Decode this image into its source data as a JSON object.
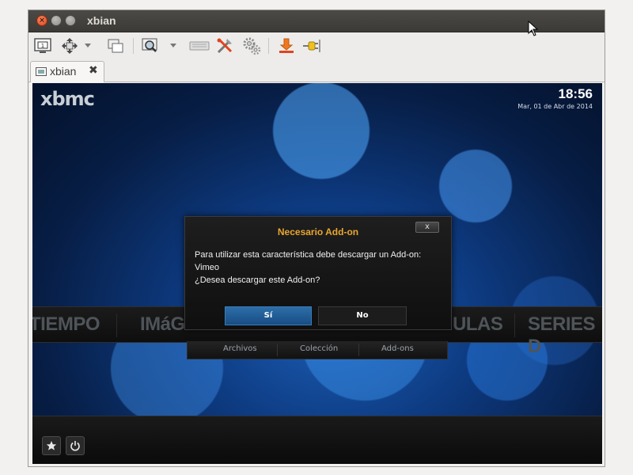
{
  "window": {
    "title": "xbian",
    "controls": [
      "close-icon",
      "minimize-icon",
      "maximize-icon"
    ]
  },
  "toolbar": {
    "buttons": [
      "fit-screen-icon",
      "move-icon",
      "dropdown-chevron",
      "windows-icon",
      "zoom-icon",
      "dropdown-chevron",
      "keyboard-icon",
      "tools-icon",
      "settings-gears-icon",
      "download-icon",
      "plug-icon"
    ]
  },
  "tabs": [
    {
      "label": "xbian",
      "icon": "display-icon",
      "close_icon": "close-x-icon"
    }
  ],
  "xbmc": {
    "logo": "xbmc",
    "time": "18:56",
    "date": "Mar, 01 de Abr de 2014",
    "menu": [
      "TIEMPO",
      "IMáG",
      "ULAS",
      "SERIES D"
    ],
    "submenu": [
      "Archivos",
      "Colección",
      "Add-ons"
    ],
    "bottom_buttons": [
      "star-icon",
      "power-icon"
    ]
  },
  "dialog": {
    "title": "Necesario Add-on",
    "close_label": "x",
    "lines": [
      "Para utilizar esta característica debe descargar un Add-on:",
      "Vimeo",
      "¿Desea descargar este Add-on?"
    ],
    "yes_label": "Sí",
    "no_label": "No"
  },
  "colors": {
    "dialog_title": "#e8a630",
    "focused_button": "#2c6ea8",
    "titlebar": "#3c3b37",
    "close_button": "#e0441f"
  }
}
